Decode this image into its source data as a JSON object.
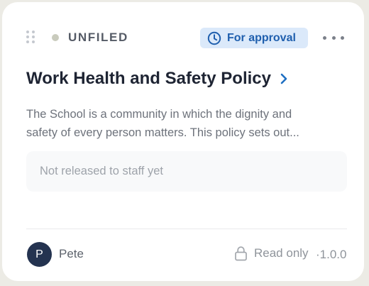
{
  "card": {
    "status": "UNFILED",
    "badge": {
      "label": "For approval",
      "icon": "clock-icon",
      "color": "#1f5fae",
      "background": "#dbe9fa"
    },
    "menu_icon": "more-horizontal-icon",
    "title": "Work Health and Safety Policy",
    "description_lines": [
      "The School is a community in which the dignity and",
      "safety of every person matters. This policy sets out..."
    ],
    "release_status": "Not released to staff yet",
    "owner": {
      "initial": "P",
      "name": "Pete",
      "avatar_color": "#243350"
    },
    "access": {
      "icon": "lock-icon",
      "label": "Read only"
    },
    "version": "·1.0.0"
  }
}
